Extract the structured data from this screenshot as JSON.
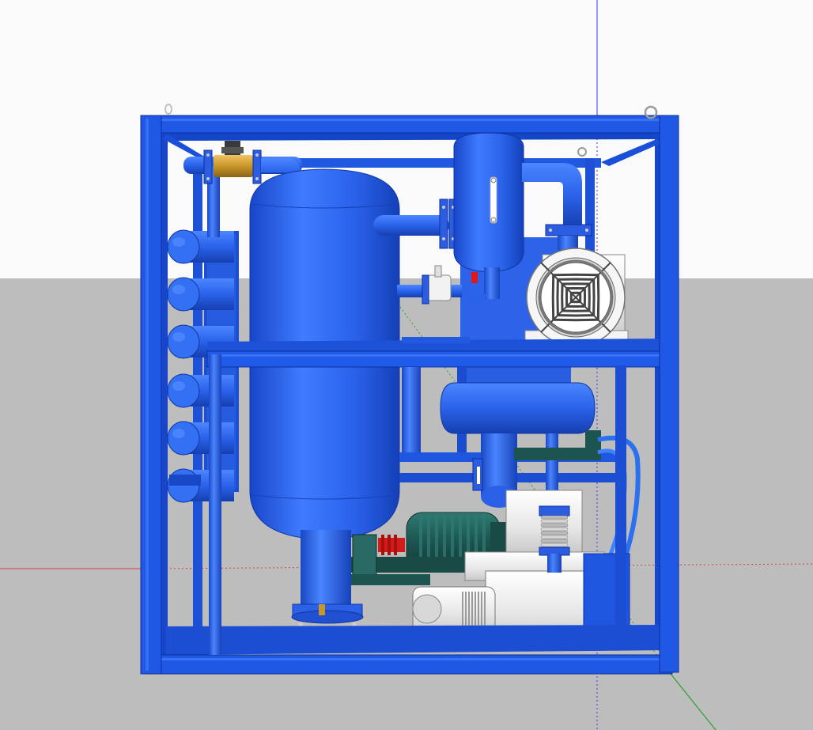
{
  "scene": {
    "colors": {
      "sky": "#fafafa",
      "ground": "#bcbcbc",
      "frame": "#1a57e6",
      "frame_dark": "#0c34a8",
      "vessel": "#2a66f0",
      "vessel_light": "#4b82ff",
      "vessel_dark": "#123fb8",
      "brass": "#c9962a",
      "motor_green": "#1f5a55",
      "pump_white": "#e9e9e9",
      "red_accent": "#e01818",
      "axis_red": "#d04040",
      "axis_green": "#2aa02a",
      "axis_blue": "#3a3af0"
    },
    "icons": [
      "lifting-eye-icon",
      "solenoid-valve-icon",
      "sight-glass-icon",
      "fan-grille-icon",
      "flexible-coupling-icon"
    ]
  }
}
